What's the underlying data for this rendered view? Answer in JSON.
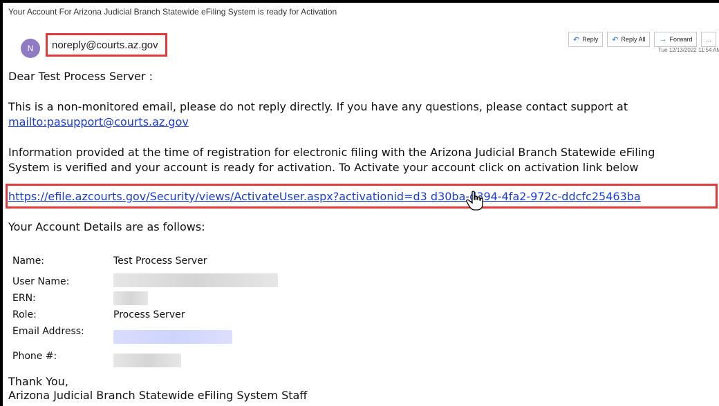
{
  "email": {
    "subject": "Your Account For Arizona Judicial Branch Statewide eFiling System is ready for Activation",
    "avatar_initial": "N",
    "from": "noreply@courts.az.gov",
    "actions": [
      {
        "label": "Reply",
        "icon": "reply-icon"
      },
      {
        "label": "Reply All",
        "icon": "reply-all-icon"
      },
      {
        "label": "Forward",
        "icon": "forward-icon"
      },
      {
        "label": "...",
        "icon": "more-icon"
      }
    ],
    "date": "Tue 12/13/2022 11:54 AM"
  },
  "body": {
    "greeting": "Dear Test Process Server :",
    "notice_line1": "This is a non-monitored email, please do not reply directly. If you have any questions, please contact support at",
    "support_link": "mailto:pasupport@courts.az.gov",
    "info_line1": "Information provided at the time of registration for electronic filing with the Arizona Judicial Branch Statewide eFiling",
    "info_line2": "System is verified and your account is ready for activation. To Activate your account click on activation link below",
    "activation_link": "https://efile.azcourts.gov/Security/views/ActivateUser.aspx?activationid=d3 d30ba-d394-4fa2-972c-ddcfc25463ba",
    "details_heading": "Your Account Details are as follows:",
    "details": [
      {
        "label": "Name:",
        "value": "Test Process Server"
      },
      {
        "label": "User Name:",
        "value": ""
      },
      {
        "label": "ERN:",
        "value": ""
      },
      {
        "label": "Role:",
        "value": "Process Server"
      },
      {
        "label": "Email Address:",
        "value": ""
      },
      {
        "label": "Phone #:",
        "value": ""
      }
    ],
    "closing1": "Thank You,",
    "closing2": "Arizona Judicial Branch Statewide eFiling System Staff"
  }
}
